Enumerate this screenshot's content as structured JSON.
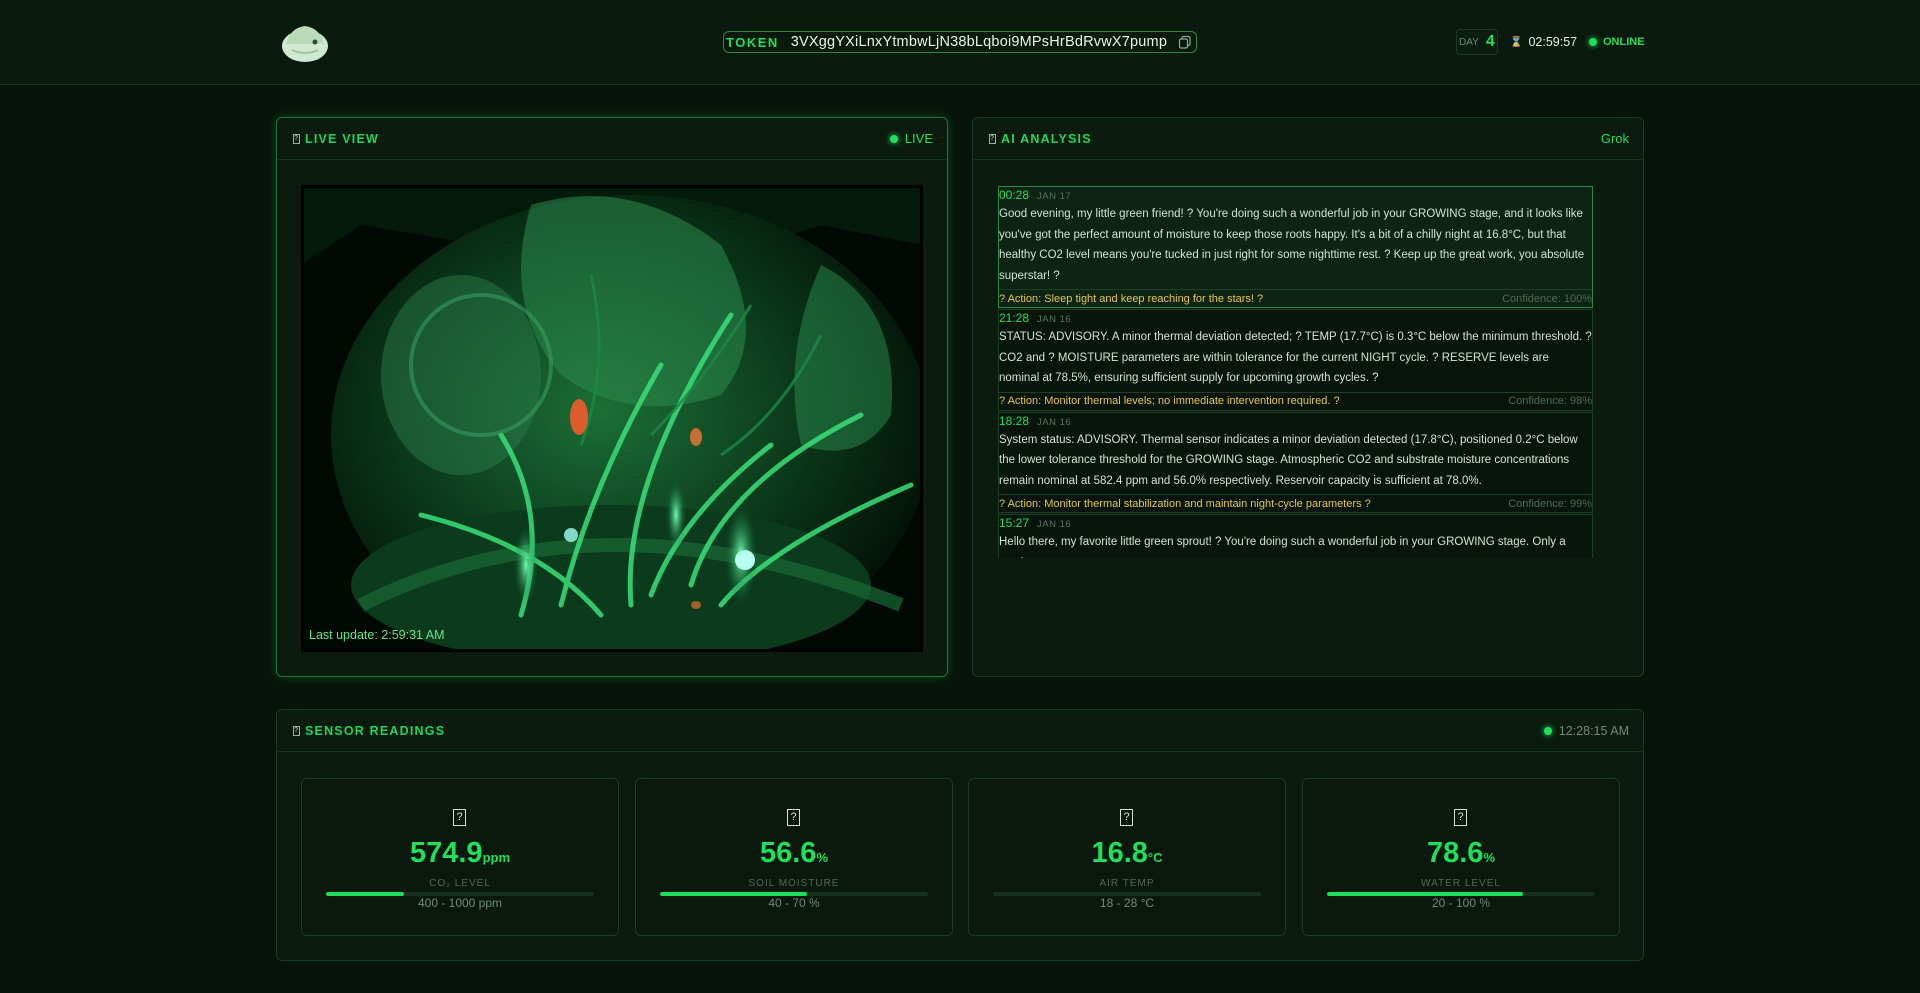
{
  "header": {
    "token_label": "TOKEN",
    "token_value": "3VXggYXiLnxYtmbwLjN38bLqboi9MPsHrBdRvwX7pump",
    "day_label": "DAY",
    "day_value": "4",
    "clock": "02:59:57",
    "status": "ONLINE"
  },
  "live": {
    "title": "LIVE VIEW",
    "badge": "LIVE",
    "last_update": "Last update: 2:59:31 AM"
  },
  "ai": {
    "title": "AI ANALYSIS",
    "model": "Grok",
    "entries": [
      {
        "time": "00:28",
        "date": "JAN 17",
        "text": "Good evening, my little green friend! ? You're doing such a wonderful job in your GROWING stage, and it looks like you've got the perfect amount of moisture to keep those roots happy. It's a bit of a chilly night at 16.8°C, but that healthy CO2 level means you're tucked in just right for some nighttime rest. ? Keep up the great work, you absolute superstar! ?",
        "action": "? Action: Sleep tight and keep reaching for the stars! ?",
        "confidence": "Confidence: 100%"
      },
      {
        "time": "21:28",
        "date": "JAN 16",
        "text": "STATUS: ADVISORY. A minor thermal deviation detected; ? TEMP (17.7°C) is 0.3°C below the minimum threshold. ? CO2 and ? MOISTURE parameters are within tolerance for the current NIGHT cycle. ? RESERVE levels are nominal at 78.5%, ensuring sufficient supply for upcoming growth cycles. ?",
        "action": "? Action: Monitor thermal levels; no immediate intervention required. ?",
        "confidence": "Confidence: 98%"
      },
      {
        "time": "18:28",
        "date": "JAN 16",
        "text": "System status: ADVISORY. Thermal sensor indicates a minor deviation detected (17.8°C), positioned 0.2°C below the lower tolerance threshold for the GROWING stage. Atmospheric CO2 and substrate moisture concentrations remain nominal at 582.4 ppm and 56.0% respectively. Reservoir capacity is sufficient at 78.0%.",
        "action": "? Action: Monitor thermal stabilization and maintain night-cycle parameters ?",
        "confidence": "Confidence: 99%"
      },
      {
        "time": "15:27",
        "date": "JAN 16",
        "text": "Hello there, my favorite little green sprout! ? You're doing such a wonderful job in your GROWING stage. Only a touch",
        "action": "",
        "confidence": ""
      }
    ]
  },
  "sensors": {
    "title": "SENSOR READINGS",
    "time": "12:28:15 AM",
    "cards": [
      {
        "value": "574.9",
        "unit": "ppm",
        "label": "CO₂ LEVEL",
        "range": "400 - 1000 ppm",
        "fill": 0.29
      },
      {
        "value": "56.6",
        "unit": "%",
        "label": "SOIL MOISTURE",
        "range": "40 - 70 %",
        "fill": 0.55
      },
      {
        "value": "16.8",
        "unit": "°C",
        "label": "AIR TEMP",
        "range": "18 - 28 °C",
        "fill": 0.0
      },
      {
        "value": "78.6",
        "unit": "%",
        "label": "WATER LEVEL",
        "range": "20 - 100 %",
        "fill": 0.73
      }
    ]
  },
  "colors": {
    "accent": "#1fe05a",
    "action": "#e6c648",
    "background": "#07140b"
  }
}
